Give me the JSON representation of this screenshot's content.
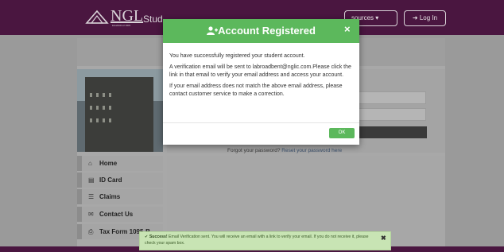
{
  "header": {
    "logo_text": "NGL",
    "logo_sub": "Established 1909",
    "site_title": "Stud",
    "resources_label": "sources ▾",
    "login_label": "➜ Log In"
  },
  "modal": {
    "title": "Account Registered",
    "close": "×",
    "para1": "You have successfully registered your student account.",
    "para2": "A verification email will be sent to labroadbent@nglic.com.Please click the link in that email to verify your email address and access your account.",
    "para3": "If your email address does not match the above email address, please contact customer service to make a correction.",
    "ok_label": "OK"
  },
  "form": {
    "forgot_text": "Forgot your password?",
    "reset_link": "Reset your password here"
  },
  "nav": {
    "items": [
      {
        "icon": "⌂",
        "label": "Home"
      },
      {
        "icon": "▤",
        "label": "ID Card"
      },
      {
        "icon": "☰",
        "label": "Claims"
      },
      {
        "icon": "✉",
        "label": "Contact Us"
      },
      {
        "icon": "⎙",
        "label": "Tax Form 1095-B"
      }
    ]
  },
  "toast": {
    "check": "✔",
    "strong": "Success!",
    "text": " Email Verification sent. You will receive an email with a link to verify your email. If you do not receive it, please check your spam box.",
    "close": "✖"
  }
}
